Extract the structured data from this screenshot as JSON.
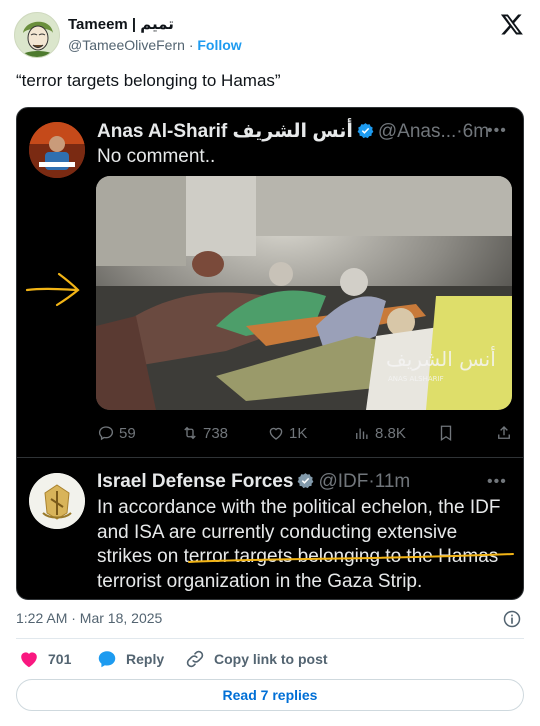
{
  "author": {
    "display_name": "Tameem | تميم",
    "handle": "@TameeOliveFern",
    "separator": "·",
    "follow_label": "Follow"
  },
  "tweet": {
    "text": "“terror targets belonging to Hamas”"
  },
  "quote1": {
    "display_name": "Anas Al-Sharif أنس الشريف",
    "handle": "@Anas...",
    "separator": "·",
    "time": "6m",
    "text": "No comment..",
    "photo_watermark": "أنس الشريف",
    "photo_watermark_sub": "ANAS ALSHARIF",
    "actions": {
      "replies": "59",
      "retweets": "738",
      "likes": "1K",
      "views": "8.8K"
    }
  },
  "quote2": {
    "display_name": "Israel Defense Forces",
    "handle": "@IDF",
    "separator": "·",
    "time": "11m",
    "body": "In accordance with the political echelon, the IDF and ISA are currently conducting extensive strikes on terror targets belonging to the Hamas terrorist organization in the Gaza Strip."
  },
  "footer": {
    "timestamp": "1:22 AM · Mar 18, 2025",
    "likes": "701",
    "reply_label": "Reply",
    "copy_label": "Copy link to post",
    "read_replies_label": "Read 7 replies"
  },
  "colors": {
    "accent": "#1d9bf0",
    "like": "#f91880",
    "annotation": "#f2b416"
  }
}
